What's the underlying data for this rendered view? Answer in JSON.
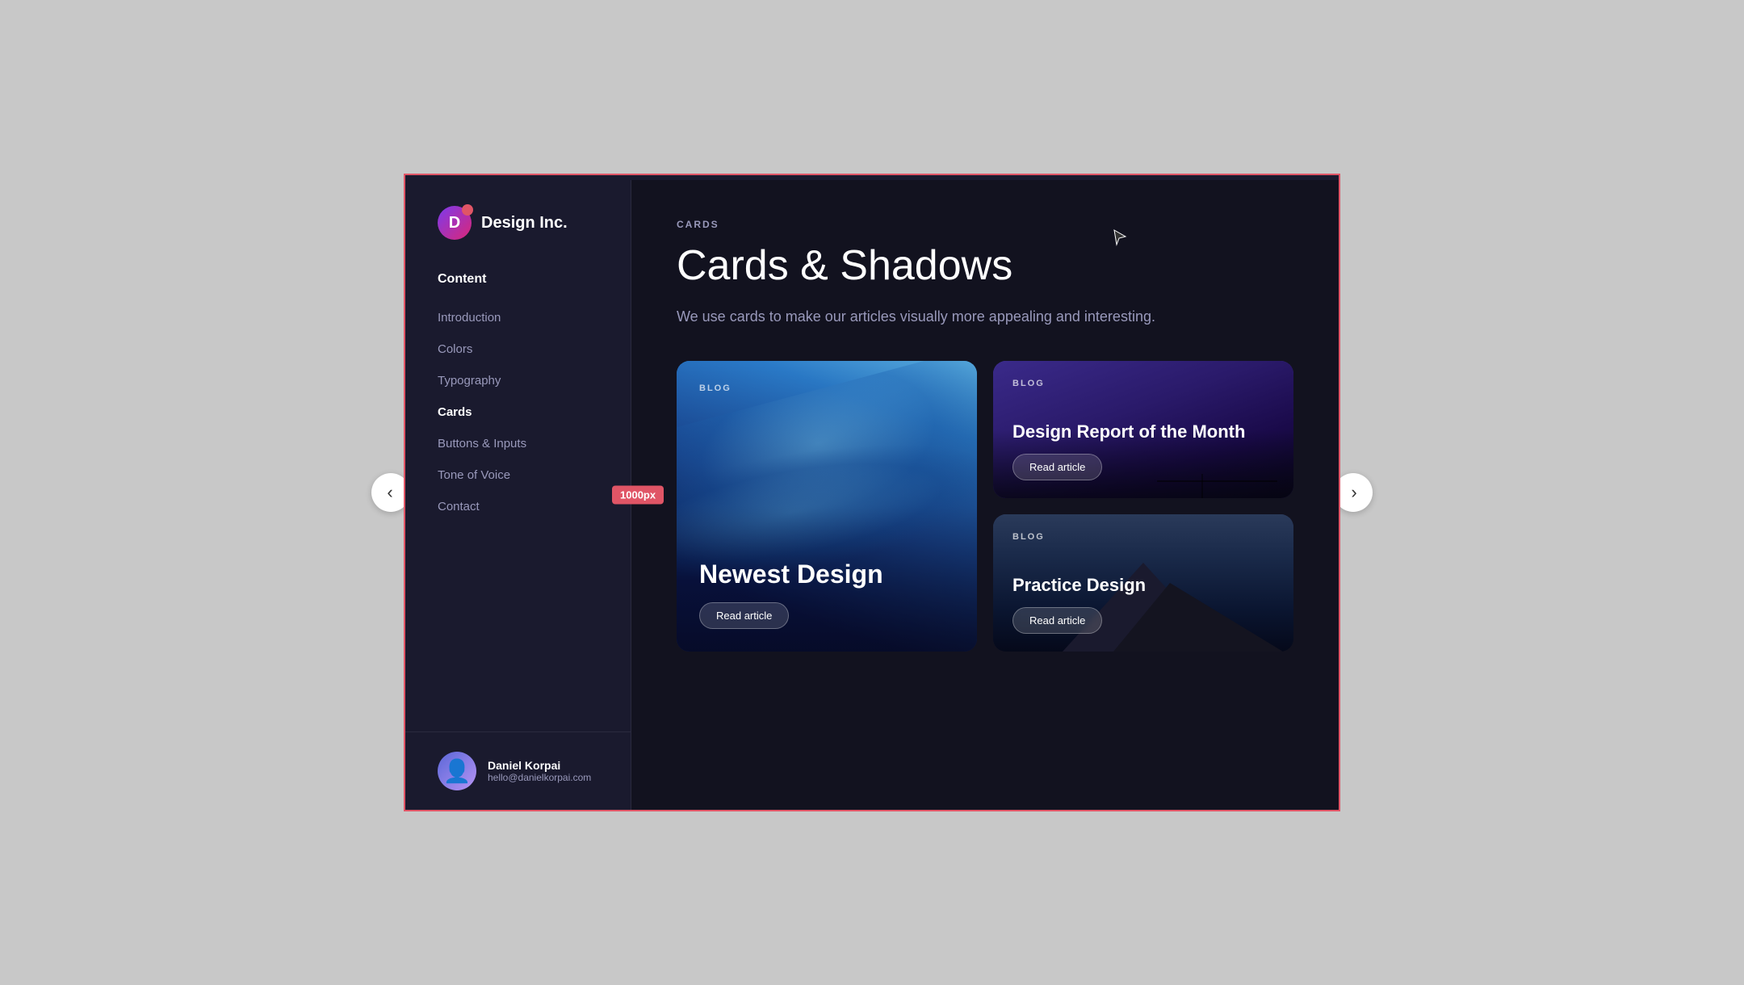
{
  "logo": {
    "letter": "D",
    "company_name": "Design Inc."
  },
  "sidebar": {
    "section_label": "Content",
    "nav_items": [
      {
        "id": "introduction",
        "label": "Introduction",
        "active": false
      },
      {
        "id": "colors",
        "label": "Colors",
        "active": false
      },
      {
        "id": "typography",
        "label": "Typography",
        "active": false
      },
      {
        "id": "cards",
        "label": "Cards",
        "active": true
      },
      {
        "id": "buttons-inputs",
        "label": "Buttons & Inputs",
        "active": false
      },
      {
        "id": "tone-of-voice",
        "label": "Tone of Voice",
        "active": false
      },
      {
        "id": "contact",
        "label": "Contact",
        "active": false
      }
    ],
    "footer": {
      "name": "Daniel Korpai",
      "email": "hello@danielkorpai.com"
    }
  },
  "width_badge": "1000px",
  "main": {
    "page_label": "CARDS",
    "page_title": "Cards & Shadows",
    "page_description": "We use cards to make our articles visually more appealing and interesting.",
    "cards": [
      {
        "id": "newest-design",
        "size": "large",
        "badge": "BLOG",
        "title": "Newest Design",
        "read_label": "Read article",
        "image_style": "ocean-wave"
      },
      {
        "id": "design-report",
        "size": "small",
        "badge": "BLOG",
        "title": "Design Report of the Month",
        "read_label": "Read article",
        "image_style": "night-sky"
      },
      {
        "id": "practice-design",
        "size": "small",
        "badge": "BLOG",
        "title": "Practice Design",
        "read_label": "Read article",
        "image_style": "mountain"
      }
    ]
  },
  "navigation": {
    "prev_arrow": "‹",
    "next_arrow": "›"
  }
}
